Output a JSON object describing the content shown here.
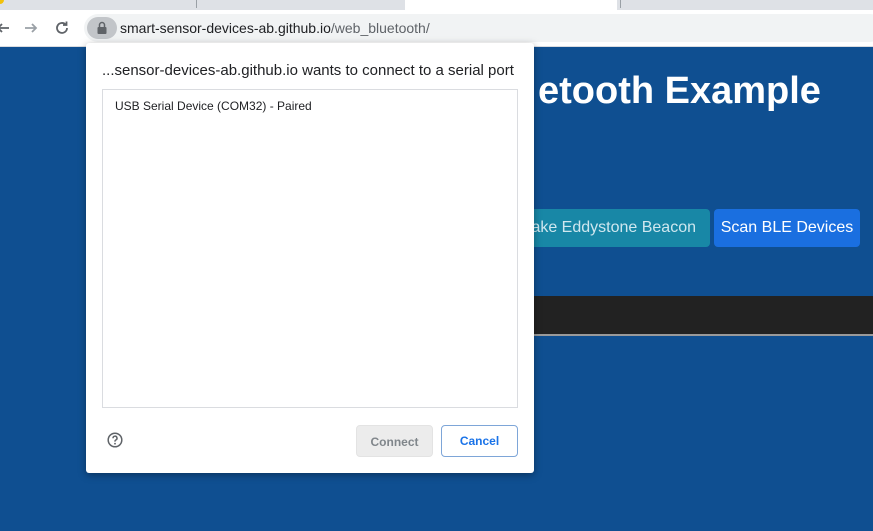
{
  "browser": {
    "url_host": "smart-sensor-devices-ab.github.io",
    "url_path": "/web_bluetooth/"
  },
  "page": {
    "title": "etooth Example",
    "eddystone_button": "Make Eddystone Beacon",
    "scan_button": "Scan BLE Devices"
  },
  "dialog": {
    "title": "...sensor-devices-ab.github.io wants to connect to a serial port",
    "devices": [
      {
        "label": "USB Serial Device (COM32) - Paired"
      }
    ],
    "connect_label": "Connect",
    "cancel_label": "Cancel"
  },
  "colors": {
    "page_bg": "#0f4f91",
    "accent": "#1a73e8",
    "scan_button": "#1a6fe0",
    "eddystone_button": "#1887a6"
  }
}
